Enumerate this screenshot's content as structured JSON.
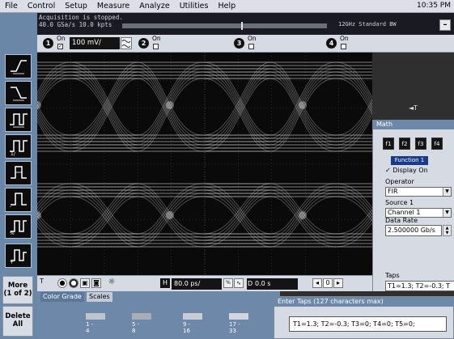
{
  "menu": {
    "items": [
      "File",
      "Control",
      "Setup",
      "Measure",
      "Analyze",
      "Utilities",
      "Help"
    ],
    "time": "10:35 PM"
  },
  "status": {
    "line1": "Acquisition is stopped.",
    "line2": "40.0 GSa/s  10.0 kpts",
    "bandwidth": "12GHz Standard BW",
    "minimize_label": "–"
  },
  "channels": {
    "ch1": {
      "number": "1",
      "on_label": "On",
      "checked": "✓",
      "scale": "100 mV/"
    },
    "ch2": {
      "number": "2",
      "on_label": "On"
    },
    "ch3": {
      "number": "3",
      "on_label": "On"
    },
    "ch4": {
      "number": "4",
      "on_label": "On"
    }
  },
  "left_panel": {
    "more_label": "More",
    "more_sub": "(1 of 2)",
    "delete_label": "Delete",
    "delete_sub": "All"
  },
  "math_panel": {
    "title": "Math",
    "function_buttons": [
      "f1",
      "f2",
      "f3",
      "f4"
    ],
    "function_label": "Function 1",
    "display_on_label": "Display On",
    "display_on_check": "✓",
    "operator_label": "Operator",
    "operator_value": "FIR",
    "source_label": "Source 1",
    "source_value": "Channel 1",
    "data_rate_label": "Data Rate",
    "data_rate_value": "2.500000 Gb/s",
    "taps_label": "Taps",
    "taps_value": "T1=1.3; T2=-0.3; T"
  },
  "controls": {
    "timebase": "80.0 ps/",
    "delay": "0.0 s",
    "h_label": "H",
    "delay_label": "D",
    "delay_value_small": "0",
    "trig_marker": "T"
  },
  "tabs": [
    "Color Grade",
    "Scales"
  ],
  "color_grade": {
    "labels": [
      "1 -\n4",
      "5 -\n8",
      "9 -\n16",
      "17 -\n33"
    ],
    "colors": [
      "#c0c4cc",
      "#a8adb8",
      "#c8ccd3",
      "#d2d5db"
    ]
  },
  "taps_dialog": {
    "title": "Enter Taps (127 characters max)",
    "value": "T1=1.3; T2=-0.3; T3=0; T4=0; T5=0;"
  }
}
